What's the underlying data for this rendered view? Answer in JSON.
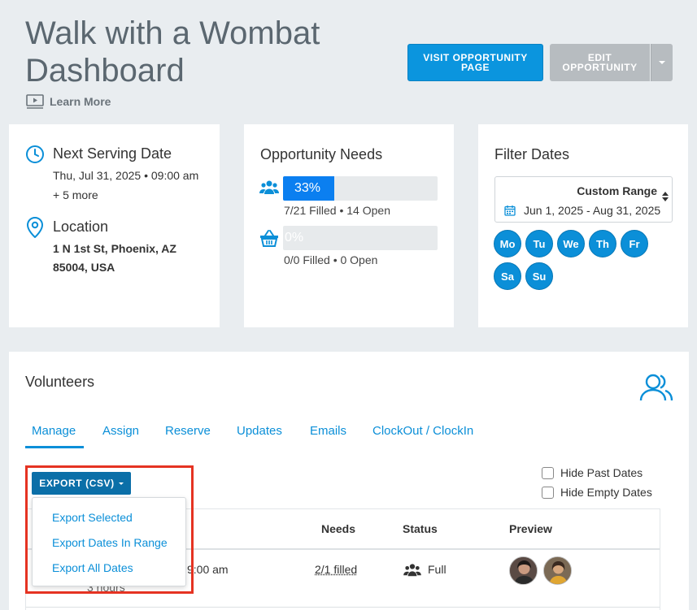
{
  "header": {
    "title": "Walk with a Wombat Dashboard",
    "learn_more": "Learn More",
    "visit_button": "VISIT OPPORTUNITY PAGE",
    "edit_button": "EDIT OPPORTUNITY"
  },
  "serving": {
    "heading": "Next Serving Date",
    "date": "Thu, Jul 31, 2025 • 09:00 am",
    "more": "+ 5 more",
    "location_heading": "Location",
    "address_line1": "1 N 1st St, Phoenix, AZ",
    "address_line2": "85004, USA"
  },
  "needs": {
    "heading": "Opportunity Needs",
    "volunteers": {
      "percent_label": "33%",
      "filled_fraction": 0.33,
      "summary": "7/21 Filled • 14 Open"
    },
    "items": {
      "percent_label": "0%",
      "filled_fraction": 0,
      "summary": "0/0 Filled • 0 Open"
    }
  },
  "filter": {
    "heading": "Filter Dates",
    "range_title": "Custom Range",
    "range_value": "Jun 1, 2025 - Aug 31, 2025",
    "days": [
      "Mo",
      "Tu",
      "We",
      "Th",
      "Fr",
      "Sa",
      "Su"
    ]
  },
  "volunteers": {
    "heading": "Volunteers",
    "tabs": [
      "Manage",
      "Assign",
      "Reserve",
      "Updates",
      "Emails",
      "ClockOut / ClockIn"
    ],
    "active_tab": "Manage",
    "export_button": "EXPORT (CSV)",
    "export_menu": [
      "Export Selected",
      "Export Dates In Range",
      "Export All Dates"
    ],
    "hide_past": "Hide Past Dates",
    "hide_empty": "Hide Empty Dates",
    "columns": {
      "needs": "Needs",
      "status": "Status",
      "preview": "Preview"
    },
    "row": {
      "time": "9:00 am",
      "duration": "3 hours",
      "needs": "2/1 filled",
      "status": "Full"
    }
  },
  "colors": {
    "accent": "#0b8fd8",
    "button_primary": "#0b95de",
    "button_disabled": "#b7bcc0",
    "highlight": "#e53322"
  }
}
